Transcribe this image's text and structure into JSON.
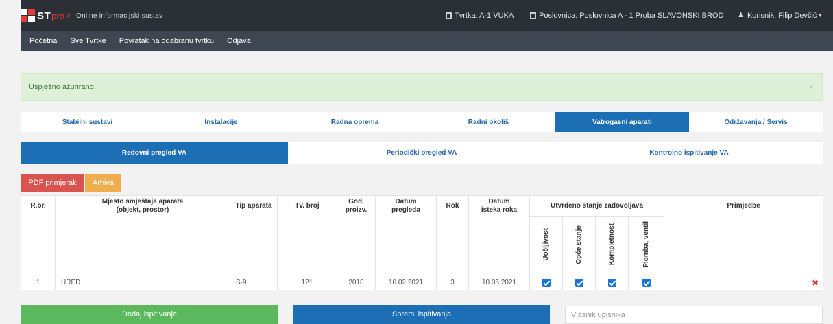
{
  "header": {
    "logo_st": "ST",
    "logo_pro": "pro",
    "logo_chevron": ">",
    "app_subtitle": "Online informacijski sustav",
    "company": "Tvrtka: A-1 VUKA",
    "branch": "Poslovnica: Poslovnica A - 1 Proba SLAVONSKI BROD",
    "user": "Korisnik: Filip Devčić",
    "user_caret": "▾"
  },
  "nav": [
    "Početna",
    "Sve Tvrtke",
    "Povratak na odabranu tvrtku",
    "Odjava"
  ],
  "alert": {
    "message": "Uspješno ažurirano.",
    "close": "×"
  },
  "category_tabs": [
    "Stabilni sustavi",
    "Instalacije",
    "Radna oprema",
    "Radni okoliš",
    "Vatrogasni aparati",
    "Održavanja / Servis"
  ],
  "active_category": "Vatrogasni aparati",
  "sub_tabs": [
    "Redovni pregled VA",
    "Periodički pregled VA",
    "Kontrolno ispitivanje VA"
  ],
  "active_sub_tab": "Redovni pregled VA",
  "buttons": {
    "pdf": "PDF primjerak",
    "arhiva": "Arhiva",
    "dodaj": "Dodaj ispitivanje",
    "spremi": "Spremi ispitivanja"
  },
  "table": {
    "headers": {
      "rbr": "R.br.",
      "mjesto_1": "Mjesto smještaja aparata",
      "mjesto_2": "(objekt, prostor)",
      "tip": "Tip aparata",
      "tv": "Tv. broj",
      "god_1": "God.",
      "god_2": "proizv.",
      "datum_pregleda_1": "Datum",
      "datum_pregleda_2": "pregleda",
      "rok": "Rok",
      "datum_isteka_1": "Datum",
      "datum_isteka_2": "isteka roka",
      "stanje": "Utvrđeno stanje zadovoljava",
      "primjedbe": "Primjedbe"
    },
    "sub_headers": [
      "Uočljivost",
      "Opće stanje",
      "Kompletnost",
      "Plomba, ventil"
    ],
    "rows": [
      {
        "rbr": "1",
        "mjesto": "URED",
        "tip": "S-9",
        "tv": "121",
        "god": "2018",
        "datum_pregleda": "10.02.2021",
        "rok": "3",
        "datum_isteka": "10.05.2021",
        "checks": [
          true,
          true,
          true,
          true
        ],
        "primjedbe": "",
        "delete": "✖"
      }
    ]
  },
  "owner_input": {
    "placeholder": "Vlasnik upisnika",
    "value": ""
  },
  "colors": {
    "topbar": "#2b2f36",
    "navbar": "#3e4652",
    "primary": "#1d6fb5",
    "success": "#5cb85c",
    "danger": "#d9534f",
    "warning": "#f0ad4e"
  }
}
